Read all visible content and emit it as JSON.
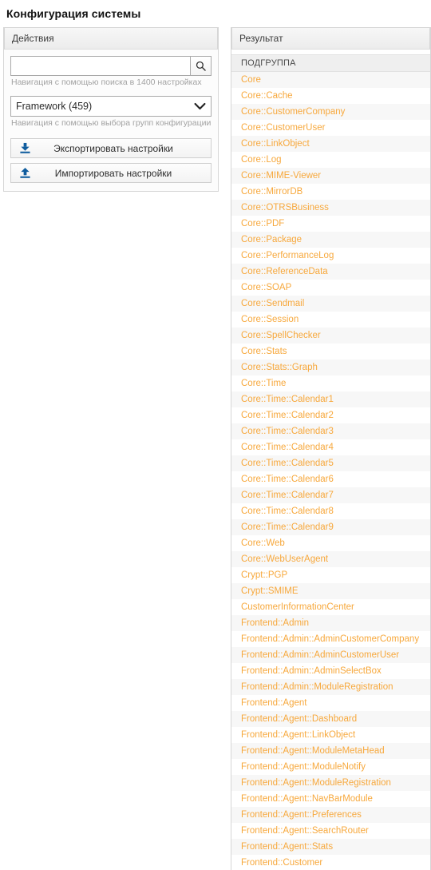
{
  "page": {
    "title": "Конфигурация системы"
  },
  "actions_panel": {
    "header": "Действия",
    "search": {
      "value": "",
      "placeholder": "",
      "icon": "search-icon",
      "hint": "Навигация с помощью поиска в 1400 настройках"
    },
    "group_select": {
      "selected": "Framework (459)",
      "caret_icon": "chevron-down-icon",
      "hint": "Навигация с помощью выбора групп конфигурации"
    },
    "buttons": [
      {
        "label": "Экспортировать настройки",
        "icon": "export-download-icon"
      },
      {
        "label": "Импортировать настройки",
        "icon": "import-upload-icon"
      }
    ]
  },
  "result_panel": {
    "header": "Результат",
    "column_header": "ПОДГРУППА",
    "items": [
      "Core",
      "Core::Cache",
      "Core::CustomerCompany",
      "Core::CustomerUser",
      "Core::LinkObject",
      "Core::Log",
      "Core::MIME-Viewer",
      "Core::MirrorDB",
      "Core::OTRSBusiness",
      "Core::PDF",
      "Core::Package",
      "Core::PerformanceLog",
      "Core::ReferenceData",
      "Core::SOAP",
      "Core::Sendmail",
      "Core::Session",
      "Core::SpellChecker",
      "Core::Stats",
      "Core::Stats::Graph",
      "Core::Time",
      "Core::Time::Calendar1",
      "Core::Time::Calendar2",
      "Core::Time::Calendar3",
      "Core::Time::Calendar4",
      "Core::Time::Calendar5",
      "Core::Time::Calendar6",
      "Core::Time::Calendar7",
      "Core::Time::Calendar8",
      "Core::Time::Calendar9",
      "Core::Web",
      "Core::WebUserAgent",
      "Crypt::PGP",
      "Crypt::SMIME",
      "CustomerInformationCenter",
      "Frontend::Admin",
      "Frontend::Admin::AdminCustomerCompany",
      "Frontend::Admin::AdminCustomerUser",
      "Frontend::Admin::AdminSelectBox",
      "Frontend::Admin::ModuleRegistration",
      "Frontend::Agent",
      "Frontend::Agent::Dashboard",
      "Frontend::Agent::LinkObject",
      "Frontend::Agent::ModuleMetaHead",
      "Frontend::Agent::ModuleNotify",
      "Frontend::Agent::ModuleRegistration",
      "Frontend::Agent::NavBarModule",
      "Frontend::Agent::Preferences",
      "Frontend::Agent::SearchRouter",
      "Frontend::Agent::Stats",
      "Frontend::Customer"
    ]
  },
  "colors": {
    "link": "#f7a83c",
    "icon_blue": "#0f5c9e",
    "header_bg": "#f2f2f2",
    "row_alt_bg": "#f7f7f7"
  }
}
